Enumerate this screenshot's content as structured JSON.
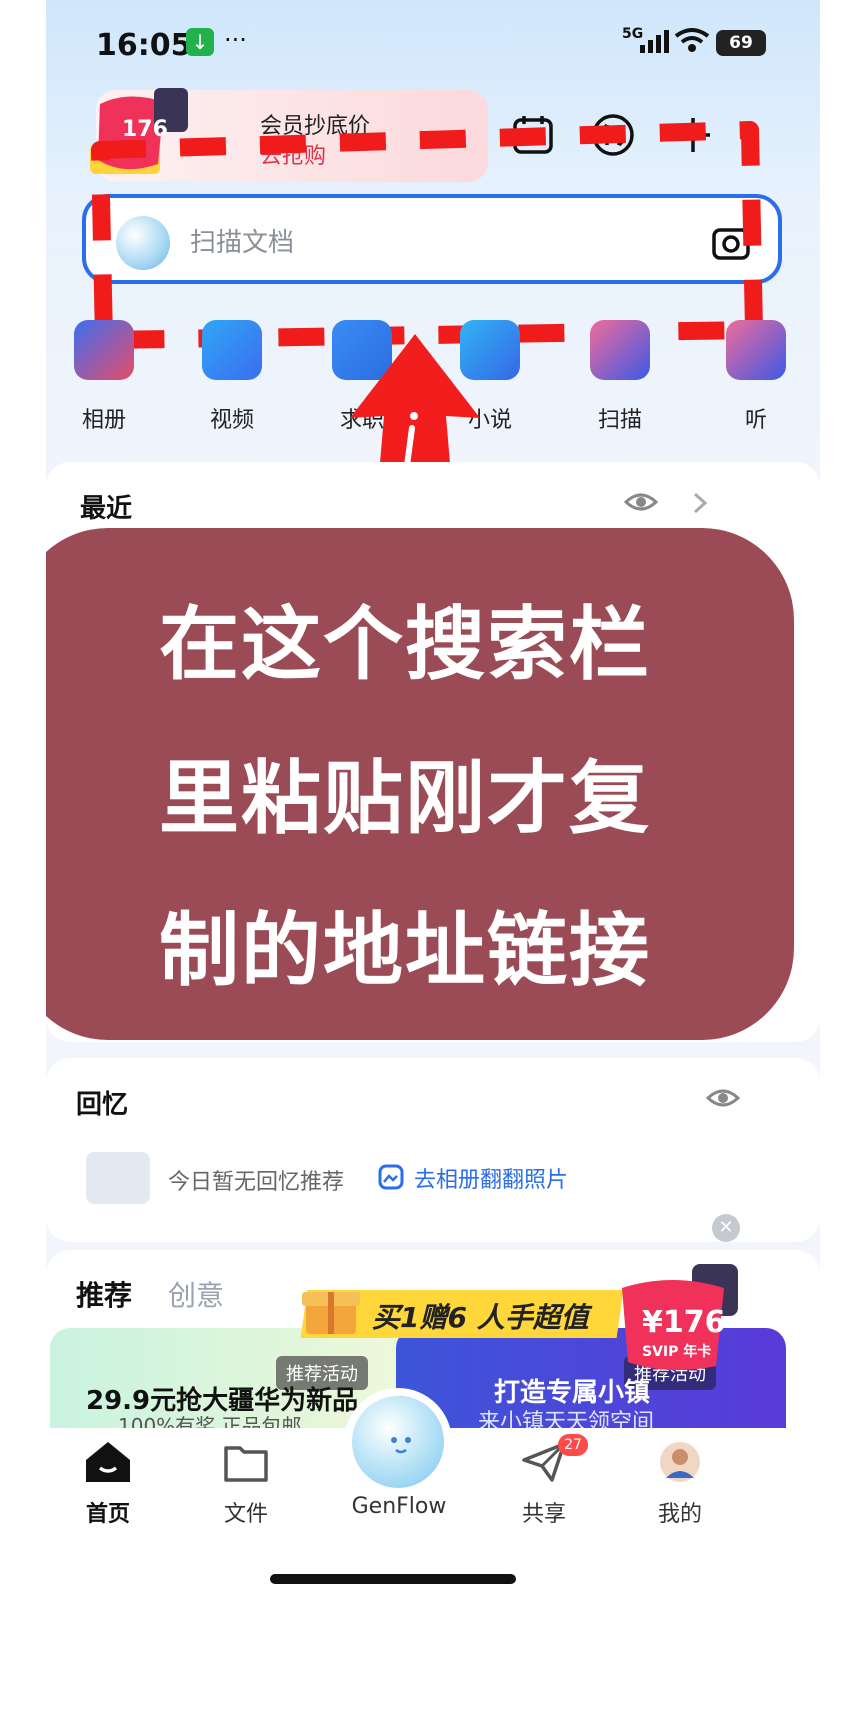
{
  "status_bar": {
    "time": "16:05",
    "more": "···",
    "network": "5G",
    "wifi_sub": "6",
    "battery": "69"
  },
  "promo": {
    "title": "会员抄底价",
    "subtitle": "去抢购",
    "badge": "176",
    "badge_sub": "年卡"
  },
  "header_icons": [
    "calendar-check-icon",
    "transfer-icon",
    "plus-icon"
  ],
  "search": {
    "placeholder": "扫描文档"
  },
  "apps": [
    {
      "label": "相册"
    },
    {
      "label": "视频"
    },
    {
      "label": "求职"
    },
    {
      "label": "小说"
    },
    {
      "label": "扫描"
    },
    {
      "label": "听"
    }
  ],
  "recent": {
    "title": "最近"
  },
  "overlay": {
    "lines": [
      "在这个搜索栏",
      "里粘贴刚才复",
      "制的地址链接"
    ]
  },
  "memory": {
    "title": "回忆",
    "empty_text": "今日暂无回忆推荐",
    "link": "去相册翻翻照片"
  },
  "recommend": {
    "tabs": [
      "推荐",
      "创意"
    ],
    "ribbon": "买1赠6 人手超值",
    "left_banner": {
      "title": "29.9元抢大疆华为新品",
      "sub": "100%有奖 正品包邮",
      "tag": "推荐活动"
    },
    "right_banner": {
      "title": "打造专属小镇",
      "sub": "来小镇天天领空间",
      "tag": "推荐活动"
    },
    "gift_price": "¥176",
    "gift_sub": "SVIP 年卡"
  },
  "nav": [
    {
      "label": "首页"
    },
    {
      "label": "文件"
    },
    {
      "label": "GenFlow"
    },
    {
      "label": "共享",
      "badge": "27"
    },
    {
      "label": "我的"
    }
  ],
  "colors": {
    "accent": "#2b6dea",
    "overlay": "#9b4b55",
    "dash": "#f01b1b"
  }
}
